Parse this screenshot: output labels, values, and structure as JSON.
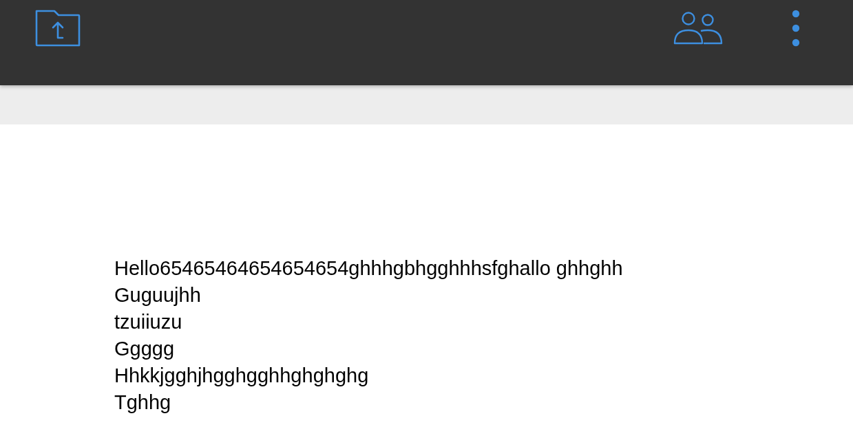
{
  "document": {
    "lines": [
      "Hello65465464654654654ghhhgbhgghhhsfghallo ghhghh",
      "Guguujhh",
      "tzuiiuzu",
      "Ggggg",
      "Hhkkjgghjhgghgghhghghghg",
      "Tghhg"
    ]
  }
}
